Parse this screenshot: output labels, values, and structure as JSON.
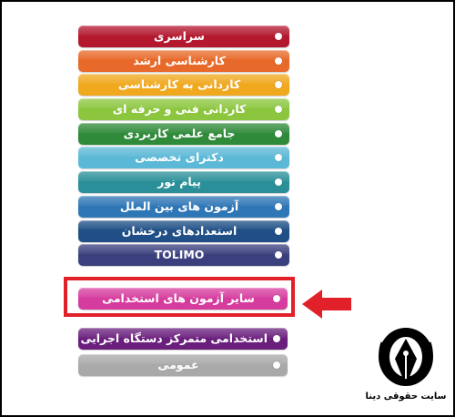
{
  "menu": {
    "items": [
      {
        "label": "سراسری",
        "color": "#b4182f"
      },
      {
        "label": "کارشناسی ارشد",
        "color": "#e86a2a"
      },
      {
        "label": "کاردانی به کارشناسی",
        "color": "#f0a81e"
      },
      {
        "label": "کاردانی فنی و حرفه ای",
        "color": "#8cc63f"
      },
      {
        "label": "جامع علمی کاربردی",
        "color": "#2f8a3a"
      },
      {
        "label": "دکترای تخصصی",
        "color": "#5bb8d6"
      },
      {
        "label": "پیام نور",
        "color": "#2a8f98"
      },
      {
        "label": "آزمون های بین الملل",
        "color": "#2e76b6"
      },
      {
        "label": "استعدادهای درخشان",
        "color": "#1f4f86"
      },
      {
        "label": "TOLIMO",
        "color": "#3a3f7e"
      }
    ],
    "highlighted_item": {
      "label": "سایر آزمون های استخدامی",
      "color": "#d63c9e"
    },
    "lower_items": [
      {
        "label": "استخدامی متمرکز دستگاه اجرایی",
        "color": "#6a1f7c"
      },
      {
        "label": "عمومی",
        "color": "#a9a9a9"
      }
    ]
  },
  "logo": {
    "caption": "سایت حقوقی دینا",
    "icon": "pen-nib-logo-icon"
  },
  "colors": {
    "highlight_border": "#e1202a",
    "arrow": "#e1202a"
  }
}
